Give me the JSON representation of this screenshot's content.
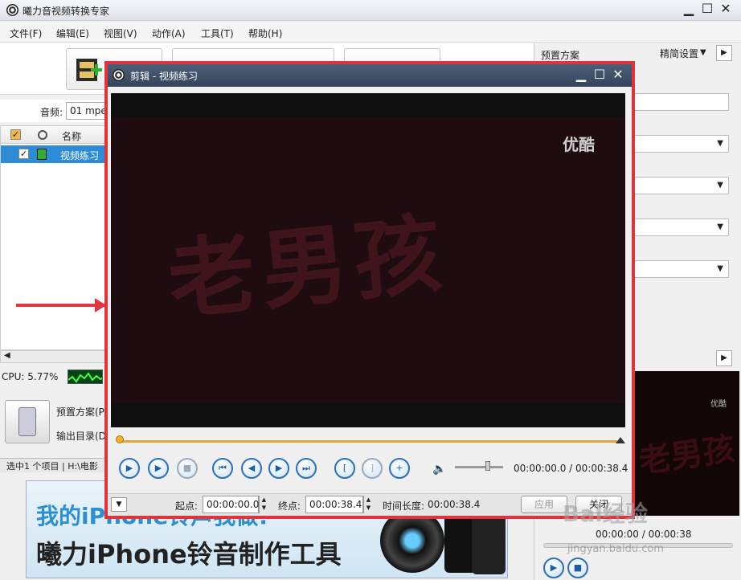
{
  "app": {
    "title": "曦力音视频转换专家"
  },
  "menu": [
    "文件(F)",
    "编辑(E)",
    "视图(V)",
    "动作(A)",
    "工具(T)",
    "帮助(H)"
  ],
  "audio": {
    "label": "音频:",
    "value": "01 mpe"
  },
  "list": {
    "col_name": "名称",
    "row_name": "视频练习"
  },
  "cpu": {
    "label": "CPU: 5.77%"
  },
  "bottom": {
    "preset_label": "预置方案(P",
    "output_label": "输出目录(D"
  },
  "status": {
    "text": "选中1 个项目 | H:\\电影"
  },
  "banner": {
    "line1": "我的iPhone铃声我做!",
    "line2": "曦力iPhone铃音制作工具"
  },
  "right_panel": {
    "header": "预置方案",
    "settings": "精简设置",
    "time": "00:00:00 / 00:00:38"
  },
  "dialog": {
    "title": "剪辑 - 视频练习",
    "watermark": "优酷",
    "video_text": "老男孩",
    "time_display": "00:00:00.0 / 00:00:38.4",
    "start_label": "起点:",
    "start_value": "00:00:00.0",
    "end_label": "终点:",
    "end_value": "00:00:38.4",
    "duration_label": "时间长度:",
    "duration_value": "00:00:38.4",
    "apply_label": "应用",
    "close_label": "关闭"
  },
  "overlay": {
    "baidu": "Bai经验",
    "url": "jingyan.baidu.com"
  }
}
